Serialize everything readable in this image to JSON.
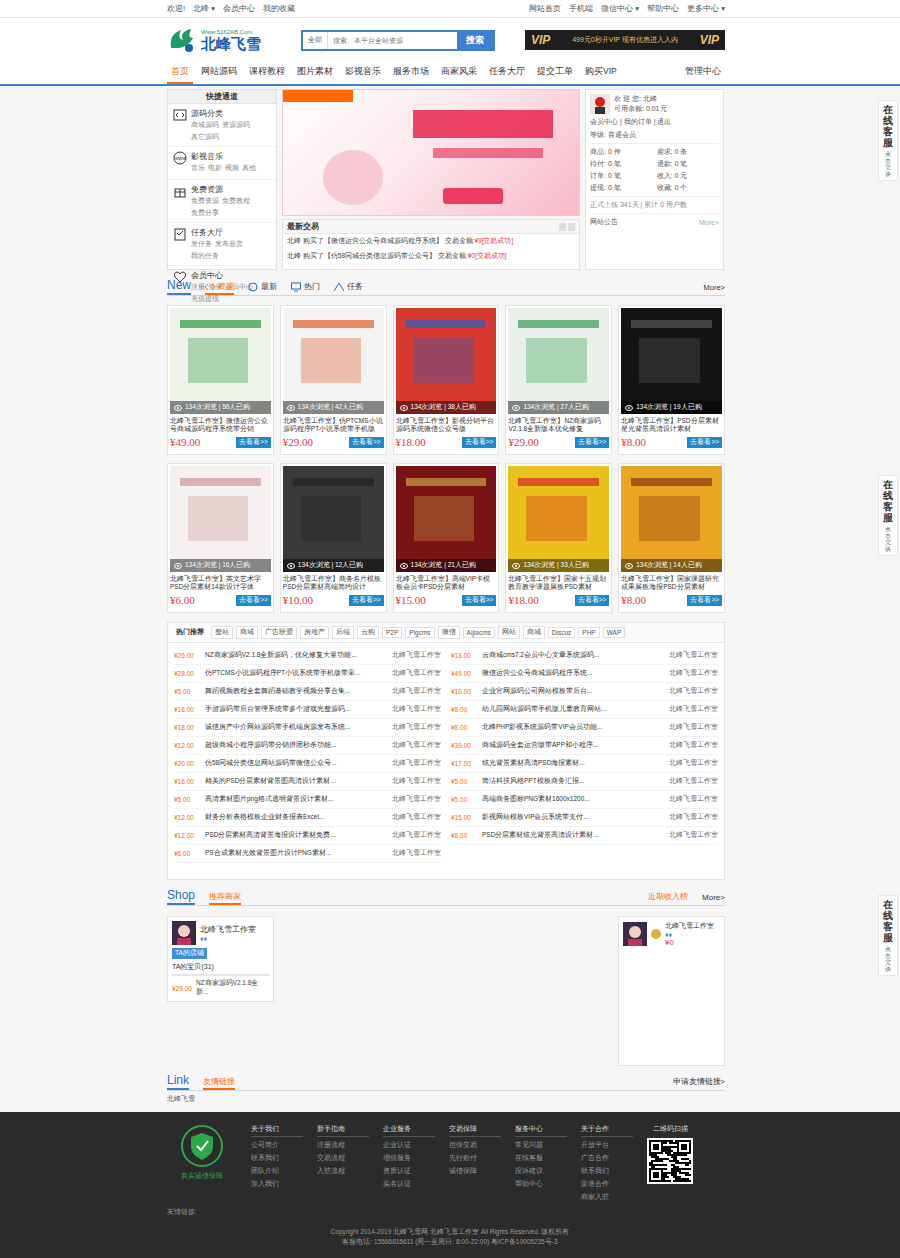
{
  "topbar": {
    "left": [
      "欢迎!",
      "北峰 ▾",
      "会员中心",
      "我的收藏"
    ],
    "right": [
      "网站首页",
      "手机端",
      "微信中心 ▾",
      "帮助中心",
      "更多中心 ▾"
    ]
  },
  "logo": {
    "name": "北峰飞雪",
    "url": "Www.5162AB.Com"
  },
  "search": {
    "scope": "全部",
    "placeholder": "搜索、本平台全站资源",
    "button": "搜索"
  },
  "vip_banner": {
    "left": "VIP",
    "text": "499元0秒开VIP  现有优惠进入入内",
    "right": "VIP"
  },
  "nav": {
    "items": [
      {
        "label": "首页",
        "selected": true
      },
      {
        "label": "网站源码",
        "selected": false
      },
      {
        "label": "课程教程",
        "selected": false
      },
      {
        "label": "图片素材",
        "selected": false
      },
      {
        "label": "影视音乐",
        "selected": false
      },
      {
        "label": "服务市场",
        "selected": false
      },
      {
        "label": "商家风采",
        "selected": false
      },
      {
        "label": "任务大厅",
        "selected": false
      },
      {
        "label": "提交工单",
        "selected": false
      },
      {
        "label": "购买VIP",
        "selected": false
      }
    ],
    "admin": "管理中心"
  },
  "service_tabs": [
    {
      "title": "在线客服",
      "sub": "点击交谈"
    },
    {
      "title": "在线客服",
      "sub": "点击交谈"
    },
    {
      "title": "在线客服",
      "sub": "点击交谈"
    }
  ],
  "quick": {
    "title": "快捷通道",
    "items": [
      {
        "title": "源码分类",
        "links": [
          "商城源码",
          "资源源码",
          "其它源码"
        ]
      },
      {
        "title": "影视音乐",
        "links": [
          "音乐",
          "电影",
          "视频",
          "其他"
        ]
      },
      {
        "title": "免费资源",
        "links": [
          "免费资源",
          "免费教程",
          "免费分享"
        ]
      },
      {
        "title": "任务大厅",
        "links": [
          "发任务",
          "发布悬赏",
          "我的任务"
        ]
      },
      {
        "title": "会员中心",
        "links": [
          "注册",
          "登录",
          "会员中心",
          "充值提现"
        ]
      }
    ]
  },
  "trades": {
    "title": "最新交易",
    "rows": [
      {
        "text": "北峰 购买了【微信运营公众号商城源码程序系统】 交易金额:",
        "amount": "¥9",
        "status": "[交易成功]"
      },
      {
        "text": "北峰 购买了【仿58同城分类信息源码带公众号】 交易金额:",
        "amount": "¥0",
        "status": "[交易成功]"
      }
    ]
  },
  "user": {
    "welcome": "欢 迎 您: 北峰",
    "balance": "可用余额: 0.01元",
    "links": "会员中心 | 我的订单 | 退出",
    "level": "等级: 普通会员",
    "stats": [
      "商品: 0 件",
      "需求: 0 条",
      "待付: 0 笔",
      "退款: 0 笔",
      "订单: 0 笔",
      "收入: 0 元",
      "提现: 0 笔",
      "收藏: 0 个"
    ],
    "online": "正式上线 341天 | 累计 0 用户数",
    "notice": "网站公告",
    "more": "More>"
  },
  "new_section": {
    "title": "New",
    "tabs": [
      {
        "label": "资源",
        "selected": true
      },
      {
        "label": "最新",
        "selected": false
      },
      {
        "label": "热门",
        "selected": false
      },
      {
        "label": "任务",
        "selected": false
      }
    ],
    "more": "More>"
  },
  "products": [
    {
      "stats": "134次浏览 | 56人已购",
      "title": "北峰飞雪工作室】微信运营公众号商城源码程序系统带分销",
      "price": "¥49.00",
      "button": "去看看>>"
    },
    {
      "stats": "134次浏览 | 42人已购",
      "title": "北峰飞雪工作室】仿PTCMS小说源码程序PT小说系统带手机版",
      "price": "¥29.00",
      "button": "去看看>>"
    },
    {
      "stats": "134次浏览 | 38人已购",
      "title": "北峰飞雪工作室】影视分销平台源码系统微信公众号版",
      "price": "¥18.00",
      "button": "去看看>>"
    },
    {
      "stats": "134次浏览 | 27人已购",
      "title": "北峰飞雪工作室】NZ商家源码V2.1.8全新版本优化修复",
      "price": "¥29.00",
      "button": "去看看>>"
    },
    {
      "stats": "134次浏览 | 19人已购",
      "title": "北峰飞雪工作室】PSD分层素材星光背景高清设计素材",
      "price": "¥8.00",
      "button": "去看看>>"
    },
    {
      "stats": "134次浏览 | 16人已购",
      "title": "北峰飞雪工作室】英文艺术字PSD分层素材14款设计字体",
      "price": "¥6.00",
      "button": "去看看>>"
    },
    {
      "stats": "134次浏览 | 12人已购",
      "title": "北峰飞雪工作室】商务名片模板PSD分层素材高端简约设计",
      "price": "¥10.00",
      "button": "去看看>>"
    },
    {
      "stats": "134次浏览 | 21人已购",
      "title": "北峰飞雪工作室】高端VIP卡模板会员卡PSD分层素材",
      "price": "¥15.00",
      "button": "去看看>>"
    },
    {
      "stats": "134次浏览 | 33人已购",
      "title": "北峰飞雪工作室】国家十五规划教育教学课题展板PSD素材",
      "price": "¥18.00",
      "button": "去看看>>"
    },
    {
      "stats": "134次浏览 | 14人已购",
      "title": "北峰飞雪工作室】国家课题研究成果展板海报PSD分层素材",
      "price": "¥8.00",
      "button": "去看看>>"
    }
  ],
  "hot": {
    "tabs": [
      {
        "label": "热门推荐",
        "selected": true
      },
      {
        "label": "整站",
        "selected": false
      },
      {
        "label": "商城",
        "selected": false
      },
      {
        "label": "广告联盟",
        "selected": false
      },
      {
        "label": "房地产",
        "selected": false
      },
      {
        "label": "后端",
        "selected": false
      },
      {
        "label": "云购",
        "selected": false
      },
      {
        "label": "P2P",
        "selected": false
      },
      {
        "label": "Pigcms",
        "selected": false
      },
      {
        "label": "微信",
        "selected": false
      },
      {
        "label": "Aijiacms",
        "selected": false
      },
      {
        "label": "网站",
        "selected": false
      },
      {
        "label": "商城",
        "selected": false
      },
      {
        "label": "Discuz",
        "selected": false
      },
      {
        "label": "PHP",
        "selected": false
      },
      {
        "label": "WAP",
        "selected": false
      }
    ],
    "left": [
      {
        "price": "¥26.00",
        "title": "NZ商家源码V2.1.8全新源码，优化修复大量功能...",
        "author": "北峰飞雪工作室"
      },
      {
        "price": "¥28.00",
        "title": "仿PTCMS小说源码程序PT小说系统带手机版带采...",
        "author": "北峰飞雪工作室"
      },
      {
        "price": "¥5.00",
        "title": "舞蹈视频教程全套舞蹈基础教学视频分享合集...",
        "author": "北峰飞雪工作室"
      },
      {
        "price": "¥18.00",
        "title": "手游源码带后台管理系统带多个游戏完整源码...",
        "author": "北峰飞雪工作室"
      },
      {
        "price": "¥18.00",
        "title": "诚信房产中介网站源码带手机端房源发布系统...",
        "author": "北峰飞雪工作室"
      },
      {
        "price": "¥12.00",
        "title": "超级商城小程序源码带分销拼团秒杀功能...",
        "author": "北峰飞雪工作室"
      },
      {
        "price": "¥20.00",
        "title": "仿58同城分类信息网站源码带微信公众号...",
        "author": "北峰飞雪工作室"
      },
      {
        "price": "¥16.00",
        "title": "精美的PSD分层素材背景图高清设计素材...",
        "author": "北峰飞雪工作室"
      },
      {
        "price": "¥5.00",
        "title": "高清素材图片png格式透明背景设计素材...",
        "author": "北峰飞雪工作室"
      },
      {
        "price": "¥12.00",
        "title": "财务分析表格模板企业财务报表Excel...",
        "author": "北峰飞雪工作室"
      },
      {
        "price": "¥12.00",
        "title": "PSD分层素材高清背景海报设计素材免费...",
        "author": "北峰飞雪工作室"
      },
      {
        "price": "¥6.00",
        "title": "PS合成素材光效背景图片设计PNG素材...",
        "author": "北峰飞雪工作室"
      }
    ],
    "right": [
      {
        "price": "¥18.00",
        "title": "云商城cms7.2会员中心文章系统源码...",
        "author": "北峰飞雪工作室"
      },
      {
        "price": "¥49.00",
        "title": "微信运营公众号商城源码程序系统...",
        "author": "北峰飞雪工作室"
      },
      {
        "price": "¥10.00",
        "title": "企业官网源码公司网站模板带后台...",
        "author": "北峰飞雪工作室"
      },
      {
        "price": "¥8.00",
        "title": "幼儿园网站源码带手机版儿童教育网站...",
        "author": "北峰飞雪工作室"
      },
      {
        "price": "¥8.00",
        "title": "北峰PHP影视系统源码带VIP会员功能...",
        "author": "北峰飞雪工作室"
      },
      {
        "price": "¥39.00",
        "title": "商城源码全套运营版带APP和小程序...",
        "author": "北峰飞雪工作室"
      },
      {
        "price": "¥17.00",
        "title": "炫光背景素材高清PSD海报素材...",
        "author": "北峰飞雪工作室"
      },
      {
        "price": "¥5.00",
        "title": "简洁科技风格PPT模板商务汇报...",
        "author": "北峰飞雪工作室"
      },
      {
        "price": "¥5.00",
        "title": "高端商务图标PNG素材1600x1200...",
        "author": "北峰飞雪工作室"
      },
      {
        "price": "¥15.00",
        "title": "影视网站模板VIP会员系统带支付...",
        "author": "北峰飞雪工作室"
      },
      {
        "price": "¥8.00",
        "title": "PSD分层素材炫光背景高清设计素材...",
        "author": "北峰飞雪工作室"
      }
    ]
  },
  "shop": {
    "title": "Shop",
    "tab": "推荐商家",
    "income_title": "近期收入榜",
    "more": "More>",
    "shops": [
      {
        "name": "北峰飞雪工作室",
        "level": "♦♦",
        "badge": "TA的店铺",
        "goods_label": "TA的宝贝(31)",
        "goods": [
          {
            "price": "¥29.00",
            "title": "NZ商家源码V2.1.8全新..."
          }
        ]
      }
    ],
    "income": [
      {
        "name": "北峰飞雪工作室",
        "level": "♦♦",
        "amount": "¥0"
      }
    ]
  },
  "links": {
    "title": "Link",
    "tab": "友情链接",
    "apply": "申请友情链接>",
    "items": [
      "北峰飞雪"
    ]
  },
  "footer": {
    "badge": "真实诚信保障",
    "columns": [
      {
        "title": "关于我们",
        "links": [
          "公司简介",
          "联系我们",
          "团队介绍",
          "加入我们"
        ]
      },
      {
        "title": "新手指南",
        "links": [
          "注册流程",
          "交易流程",
          "入驻流程"
        ]
      },
      {
        "title": "企业服务",
        "links": [
          "企业认证",
          "增值服务",
          "资质认证",
          "实名认证"
        ]
      },
      {
        "title": "交易保障",
        "links": [
          "担保交易",
          "先行赔付",
          "诚信保障"
        ]
      },
      {
        "title": "服务中心",
        "links": [
          "常见问题",
          "在线客服",
          "投诉建议",
          "帮助中心"
        ]
      },
      {
        "title": "关于合作",
        "links": [
          "开放平台",
          "广告合作",
          "联系我们",
          "渠道合作",
          "商家入驻"
        ]
      }
    ],
    "qr_title": "二维码扫描",
    "friend_label": "友情链接:",
    "copyright": "Copyright 2014-2019 北峰飞雪网 北峰飞雪工作室 All Rights Reserved. 版权所有",
    "contact": "客服电话: 15566815611 (周一至周日: 8:00-22:00)  粤ICP备10005235号-3"
  }
}
